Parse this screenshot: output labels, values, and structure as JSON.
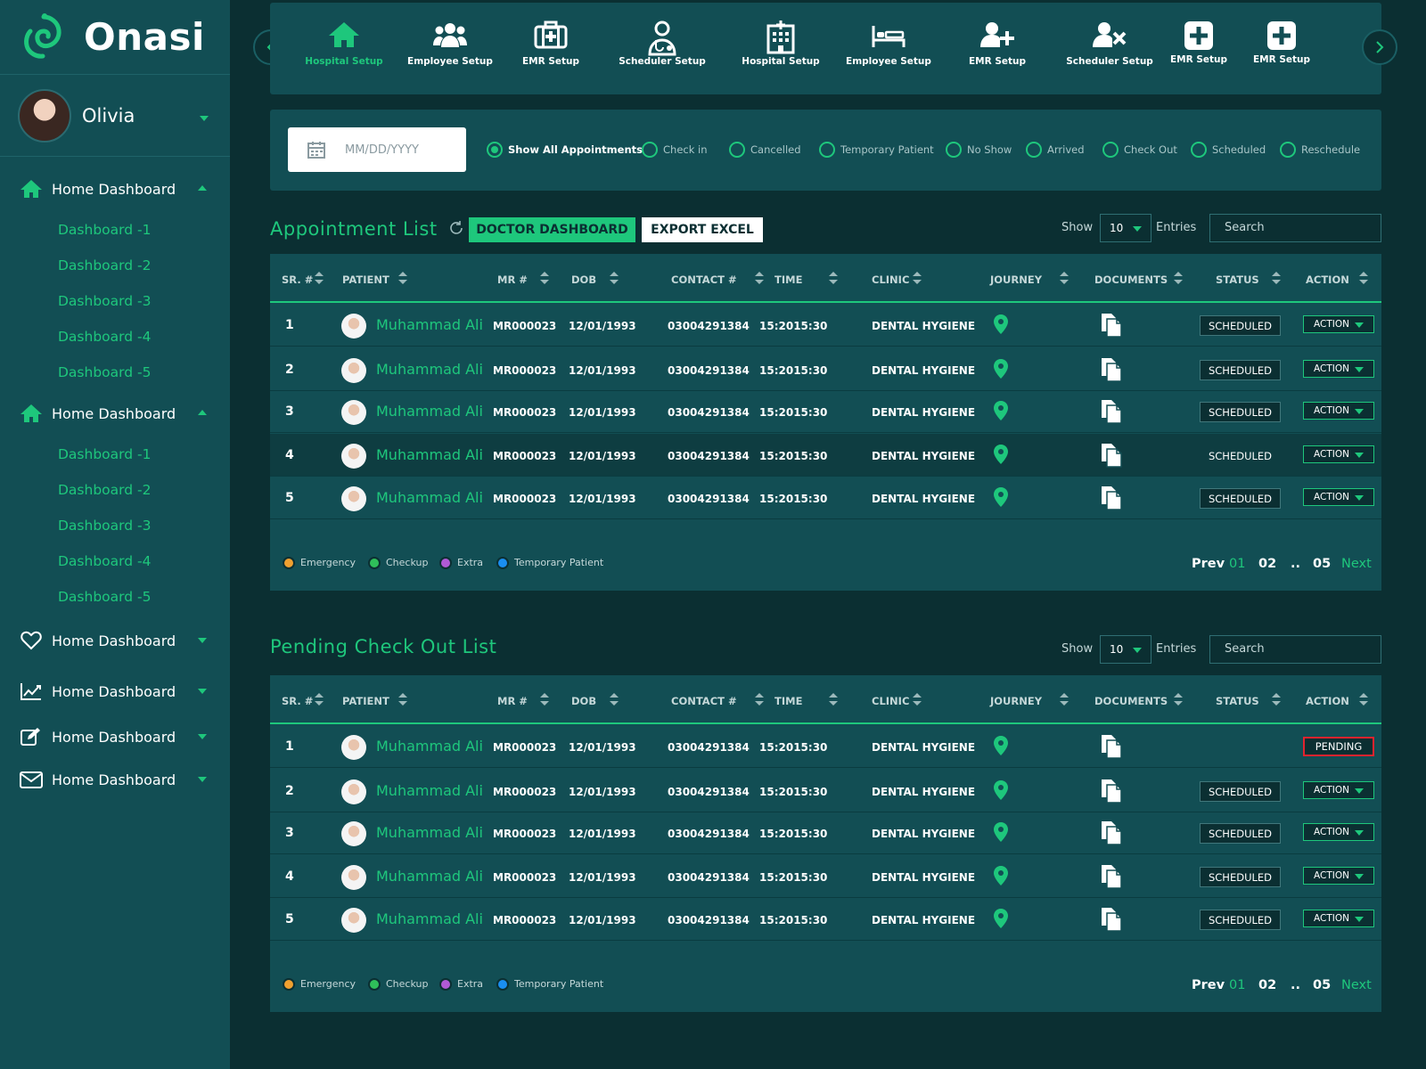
{
  "brand": {
    "name": "Onasi",
    "accent": "#1ec77c",
    "sidebar_bg": "#124e54",
    "page_bg": "#0b2f32"
  },
  "user": {
    "name": "Olivia"
  },
  "sidebar": {
    "groups": [
      {
        "label": "Home Dashboard",
        "icon": "home-icon",
        "expanded": true,
        "children": [
          "Dashboard -1",
          "Dashboard -2",
          "Dashboard -3",
          "Dashboard -4",
          "Dashboard -5"
        ]
      },
      {
        "label": "Home Dashboard",
        "icon": "home-icon",
        "expanded": true,
        "children": [
          "Dashboard -1",
          "Dashboard -2",
          "Dashboard -3",
          "Dashboard -4",
          "Dashboard -5"
        ]
      },
      {
        "label": "Home Dashboard",
        "icon": "heart-icon",
        "expanded": false
      },
      {
        "label": "Home Dashboard",
        "icon": "chart-icon",
        "expanded": false
      },
      {
        "label": "Home Dashboard",
        "icon": "edit-icon",
        "expanded": false
      },
      {
        "label": "Home Dashboard",
        "icon": "mail-icon",
        "expanded": false
      }
    ]
  },
  "toolbar": {
    "items": [
      {
        "label": "Hospital Setup",
        "icon": "home-icon",
        "active": true
      },
      {
        "label": "Employee Setup",
        "icon": "users-icon"
      },
      {
        "label": "EMR Setup",
        "icon": "medkit-icon"
      },
      {
        "label": "Scheduler Setup",
        "icon": "doctor-icon"
      },
      {
        "label": "Hospital Setup",
        "icon": "hospital-icon"
      },
      {
        "label": "Employee Setup",
        "icon": "bed-icon"
      },
      {
        "label": "EMR Setup",
        "icon": "user-plus-icon"
      },
      {
        "label": "Scheduler Setup",
        "icon": "user-x-icon"
      },
      {
        "label": "EMR Setup",
        "icon": "plus-square-icon"
      },
      {
        "label": "EMR Setup",
        "icon": "plus-square-icon"
      }
    ]
  },
  "filters": {
    "date_placeholder": "MM/DD/YYYY",
    "options": [
      "Show All Appointments",
      "Check in",
      "Cancelled",
      "Temporary Patient",
      "No Show",
      "Arrived",
      "Check Out",
      "Scheduled",
      "Reschedule"
    ],
    "selected": "Show All Appointments"
  },
  "appointment": {
    "title": "Appointment List",
    "doctor_btn": "DOCTOR DASHBOARD",
    "export_btn": "EXPORT EXCEL",
    "show_label": "Show",
    "entries_label": "Entries",
    "page_size": "10",
    "search_placeholder": "Search",
    "columns": [
      "SR. #",
      "PATIENT",
      "MR #",
      "DOB",
      "CONTACT #",
      "TIME",
      "CLINIC",
      "JOURNEY",
      "DOCUMENTS",
      "STATUS",
      "ACTION"
    ],
    "rows": [
      {
        "sr": "1",
        "patient": "Muhammad Ali",
        "mr": "MR000023",
        "dob": "12/01/1993",
        "contact": "03004291384",
        "time": "15:2015:30",
        "clinic": "DENTAL HYGIENE",
        "status": "SCHEDULED",
        "action": "ACTION"
      },
      {
        "sr": "2",
        "patient": "Muhammad Ali",
        "mr": "MR000023",
        "dob": "12/01/1993",
        "contact": "03004291384",
        "time": "15:2015:30",
        "clinic": "DENTAL HYGIENE",
        "status": "SCHEDULED",
        "action": "ACTION"
      },
      {
        "sr": "3",
        "patient": "Muhammad Ali",
        "mr": "MR000023",
        "dob": "12/01/1993",
        "contact": "03004291384",
        "time": "15:2015:30",
        "clinic": "DENTAL HYGIENE",
        "status": "SCHEDULED",
        "action": "ACTION"
      },
      {
        "sr": "4",
        "patient": "Muhammad Ali",
        "mr": "MR000023",
        "dob": "12/01/1993",
        "contact": "03004291384",
        "time": "15:2015:30",
        "clinic": "DENTAL HYGIENE",
        "status": "SCHEDULED",
        "action": "ACTION"
      },
      {
        "sr": "5",
        "patient": "Muhammad Ali",
        "mr": "MR000023",
        "dob": "12/01/1993",
        "contact": "03004291384",
        "time": "15:2015:30",
        "clinic": "DENTAL HYGIENE",
        "status": "SCHEDULED",
        "action": "ACTION"
      }
    ],
    "legend": [
      {
        "label": "Emergency",
        "color": "#f0a030"
      },
      {
        "label": "Checkup",
        "color": "#2fbf5a"
      },
      {
        "label": "Extra",
        "color": "#b05ad6"
      },
      {
        "label": "Temporary Patient",
        "color": "#1a8ef0"
      }
    ],
    "pagination": {
      "prev": "Prev",
      "pages": [
        "01",
        "02",
        "..",
        " 05"
      ],
      "next": "Next"
    }
  },
  "pending": {
    "title": "Pending Check Out List",
    "show_label": "Show",
    "entries_label": "Entries",
    "page_size": "10",
    "search_placeholder": "Search",
    "columns": [
      "SR. #",
      "PATIENT",
      "MR #",
      "DOB",
      "CONTACT #",
      "TIME",
      "CLINIC",
      "JOURNEY",
      "DOCUMENTS",
      "STATUS",
      "ACTION"
    ],
    "rows": [
      {
        "sr": "1",
        "patient": "Muhammad Ali",
        "mr": "MR000023",
        "dob": "12/01/1993",
        "contact": "03004291384",
        "time": "15:2015:30",
        "clinic": "DENTAL HYGIENE",
        "status": "",
        "action": "PENDING"
      },
      {
        "sr": "2",
        "patient": "Muhammad Ali",
        "mr": "MR000023",
        "dob": "12/01/1993",
        "contact": "03004291384",
        "time": "15:2015:30",
        "clinic": "DENTAL HYGIENE",
        "status": "SCHEDULED",
        "action": "ACTION"
      },
      {
        "sr": "3",
        "patient": "Muhammad Ali",
        "mr": "MR000023",
        "dob": "12/01/1993",
        "contact": "03004291384",
        "time": "15:2015:30",
        "clinic": "DENTAL HYGIENE",
        "status": "SCHEDULED",
        "action": "ACTION"
      },
      {
        "sr": "4",
        "patient": "Muhammad Ali",
        "mr": "MR000023",
        "dob": "12/01/1993",
        "contact": "03004291384",
        "time": "15:2015:30",
        "clinic": "DENTAL HYGIENE",
        "status": "SCHEDULED",
        "action": "ACTION"
      },
      {
        "sr": "5",
        "patient": "Muhammad Ali",
        "mr": "MR000023",
        "dob": "12/01/1993",
        "contact": "03004291384",
        "time": "15:2015:30",
        "clinic": "DENTAL HYGIENE",
        "status": "SCHEDULED",
        "action": "ACTION"
      }
    ],
    "legend": [
      {
        "label": "Emergency",
        "color": "#f0a030"
      },
      {
        "label": "Checkup",
        "color": "#2fbf5a"
      },
      {
        "label": "Extra",
        "color": "#b05ad6"
      },
      {
        "label": "Temporary Patient",
        "color": "#1a8ef0"
      }
    ],
    "pagination": {
      "prev": "Prev",
      "pages": [
        "01",
        "02",
        "..",
        "05"
      ],
      "next": "Next"
    }
  }
}
